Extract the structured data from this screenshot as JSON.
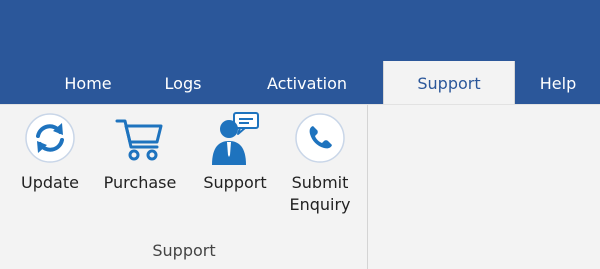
{
  "tabs": [
    {
      "label": "Home"
    },
    {
      "label": "Logs"
    },
    {
      "label": "Activation"
    },
    {
      "label": "Support",
      "active": true
    },
    {
      "label": "Help"
    }
  ],
  "ribbon": {
    "buttons": [
      {
        "label": "Update",
        "icon": "refresh-icon"
      },
      {
        "label": "Purchase",
        "icon": "cart-icon"
      },
      {
        "label": "Support",
        "icon": "support-agent-icon"
      },
      {
        "label_line1": "Submit",
        "label_line2": "Enquiry",
        "icon": "phone-icon"
      }
    ],
    "group_label": "Support"
  },
  "colors": {
    "accent": "#2b579a",
    "icon_blue": "#1e73be",
    "ribbon_bg": "#f3f3f3"
  }
}
